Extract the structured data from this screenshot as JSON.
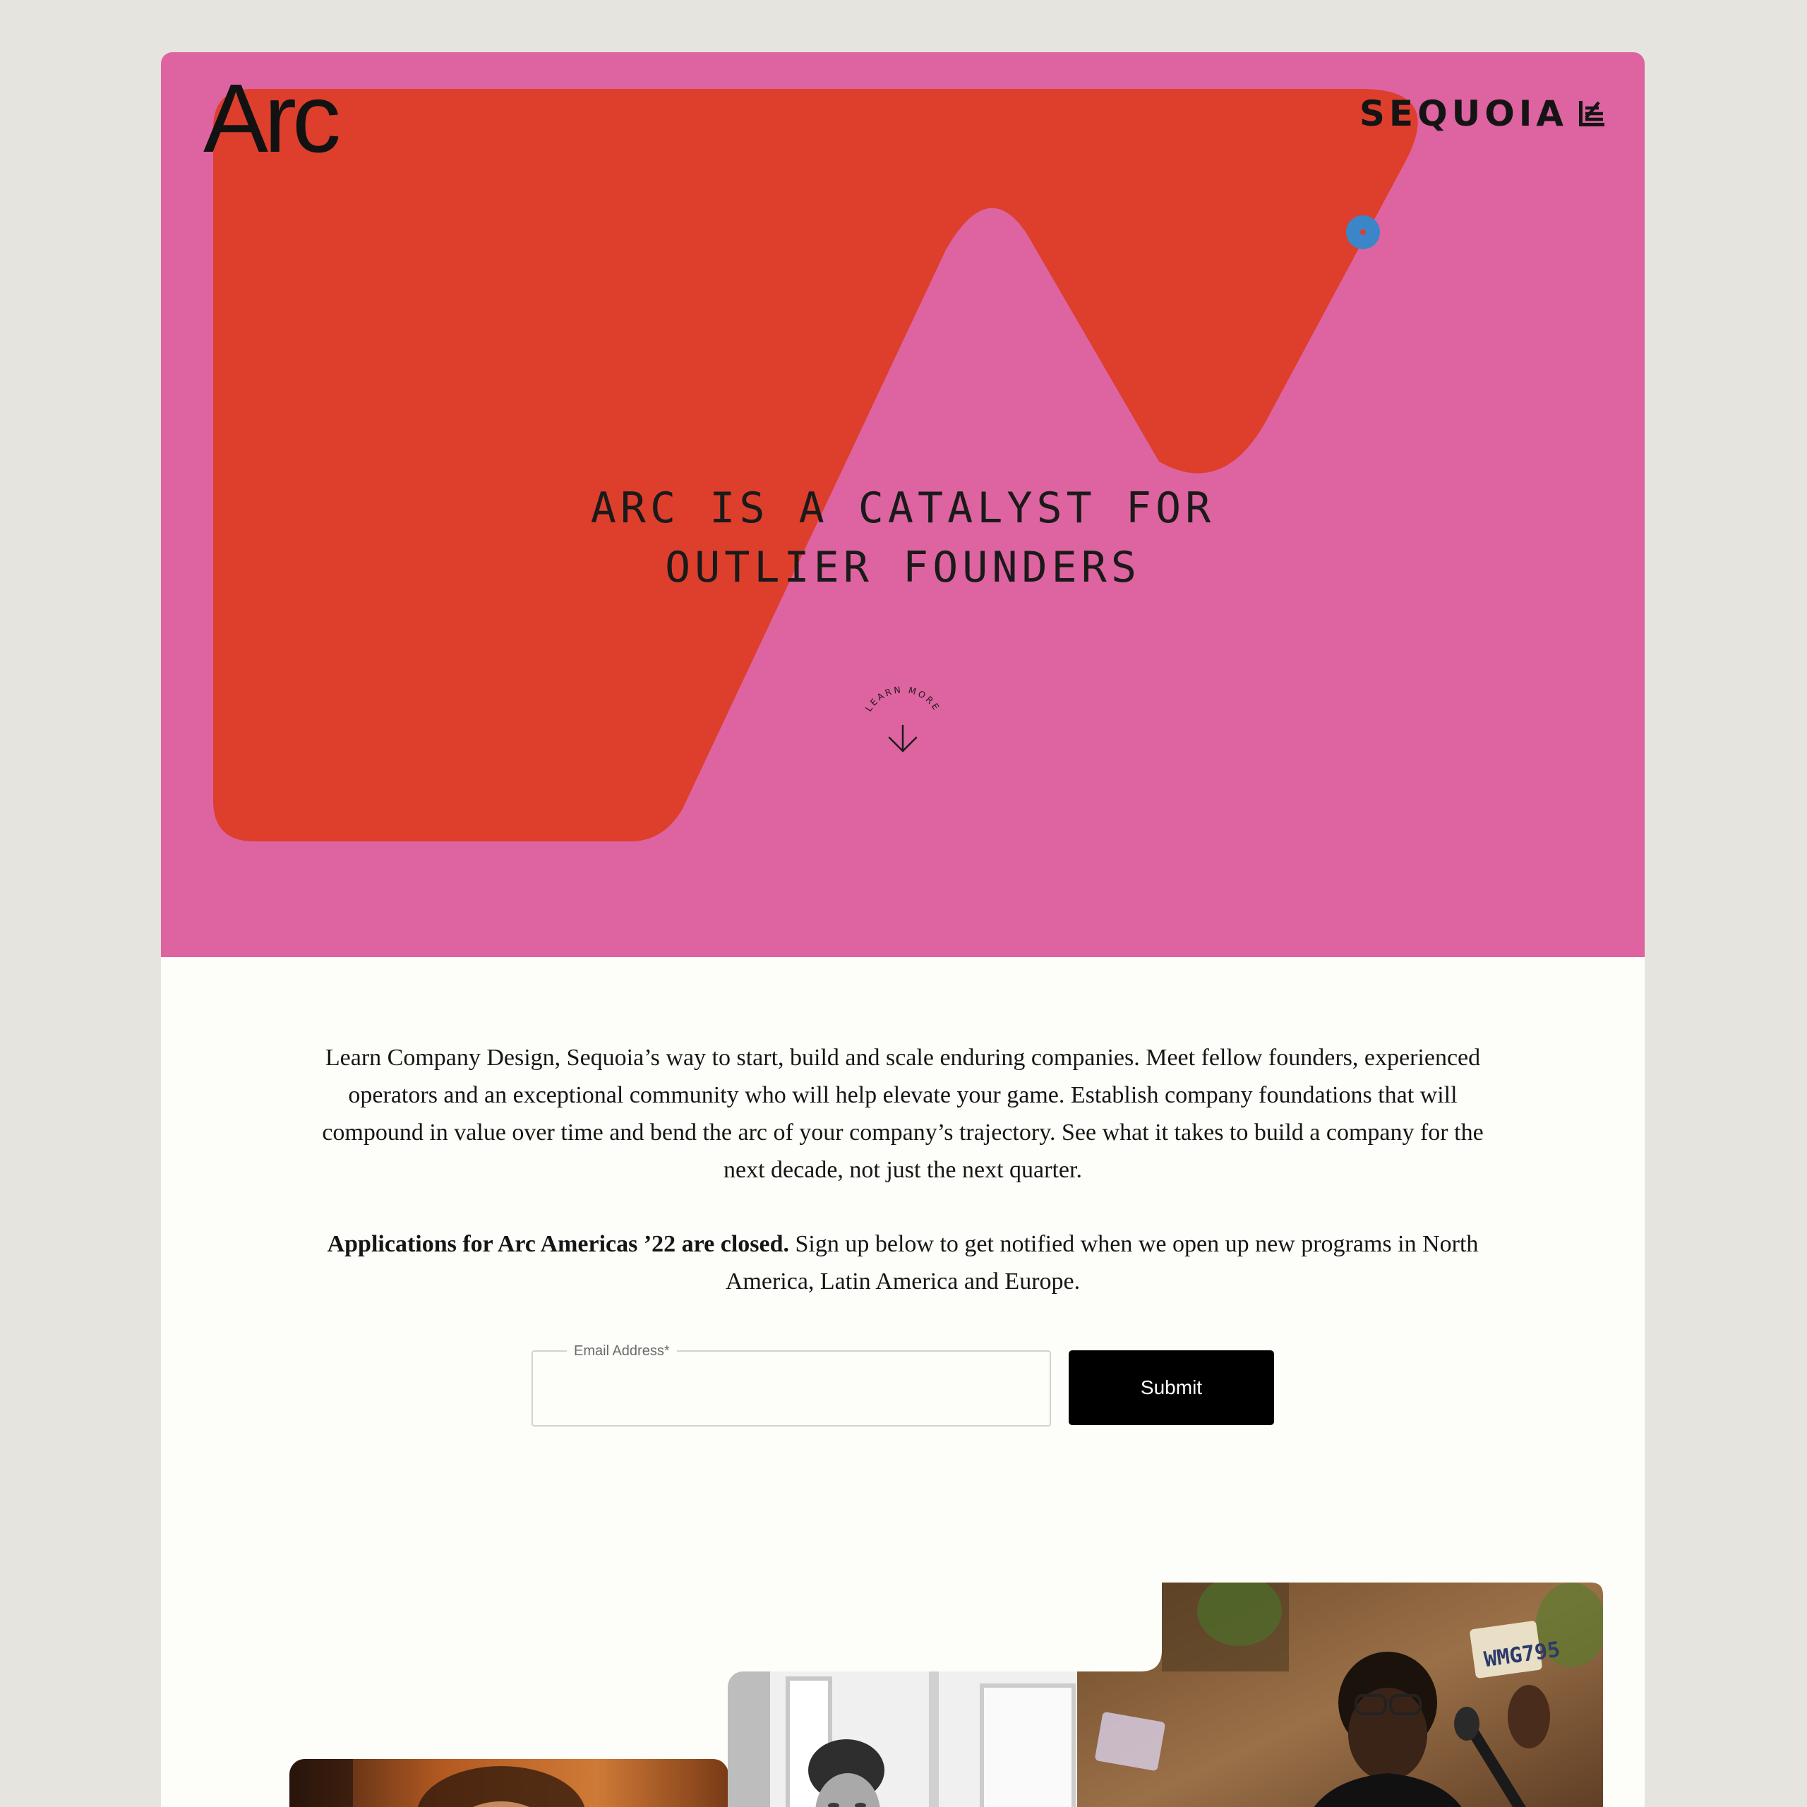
{
  "brand": {
    "logo_text": "Arc",
    "partner_name": "SEQUOIA",
    "partner_icon": "sequoia-leaf-icon"
  },
  "hero": {
    "headline_line1": "ARC IS A CATALYST FOR",
    "headline_line2": "OUTLIER FOUNDERS",
    "learn_more_label": "LEARN MORE",
    "background_color": "#dd64a0",
    "shape_color": "#dd3f2c",
    "dot_color": "#3b86c8"
  },
  "intro": {
    "paragraph": "Learn Company Design, Sequoia’s way to start, build and scale enduring companies. Meet fellow founders, experienced operators and an exceptional community who will help elevate your game. Establish company foundations that will compound in value over time and bend the arc of your company’s trajectory. See what it takes to build a company for the next decade, not just the next quarter.",
    "status_bold": "Applications for Arc Americas ’22 are closed.",
    "status_rest": " Sign up below to get notified when we open up new programs in North America, Latin America and Europe."
  },
  "signup": {
    "email_label": "Email Address*",
    "email_value": "",
    "submit_label": "Submit"
  },
  "colors": {
    "page_background": "#e6e4de",
    "content_background": "#fdfdf9",
    "button_background": "#000000"
  }
}
